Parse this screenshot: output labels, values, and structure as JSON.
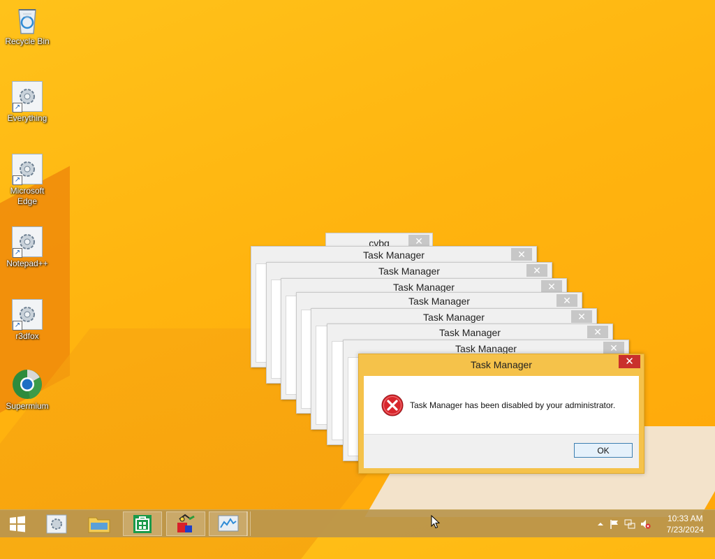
{
  "desktop_icons": [
    {
      "label": "Recycle Bin",
      "icon": "recycle-bin-icon"
    },
    {
      "label": "Everything",
      "icon": "app-shortcut-icon"
    },
    {
      "label": "Microsoft Edge",
      "icon": "app-shortcut-icon"
    },
    {
      "label": "Notepad++",
      "icon": "app-shortcut-icon"
    },
    {
      "label": "r3dfox",
      "icon": "app-shortcut-icon"
    },
    {
      "label": "Supermium",
      "icon": "supermium-icon"
    }
  ],
  "background_windows": {
    "top_title": "cvbq",
    "titles": [
      "Task Manager",
      "Task Manager",
      "Task Manager",
      "Task Manager",
      "Task Manager",
      "Task Manager",
      "Task Manager"
    ]
  },
  "dialog": {
    "title": "Task Manager",
    "message": "Task Manager has been disabled by your administrator.",
    "ok_label": "OK",
    "close_glyph": "✕"
  },
  "taskbar": {
    "apps": [
      "start-button",
      "settings-app",
      "file-explorer",
      "store",
      "paint-app",
      "task-manager-app"
    ],
    "clock_time": "10:33 AM",
    "clock_date": "7/23/2024"
  },
  "colors": {
    "desktop": "#ffb410",
    "dialog_frame": "#f5c24a",
    "close_red": "#c9302c",
    "taskbar": "#ba964e"
  }
}
